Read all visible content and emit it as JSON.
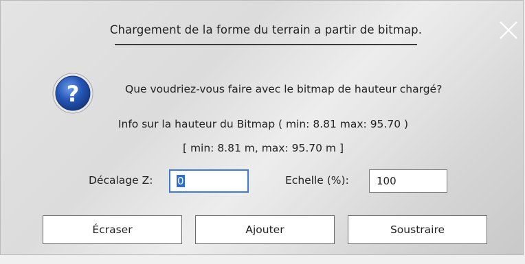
{
  "dialog": {
    "title": "Chargement de la forme du terrain a partir de bitmap.",
    "close_icon": "close-icon",
    "help_icon": "question-mark-icon",
    "question": "Que voudriez-vous faire avec le bitmap de hauteur chargé?",
    "info": "Info sur la hauteur du Bitmap ( min: 8.81 max: 95.70 )",
    "range": "[ min: 8.81 m, max: 95.70 m ]",
    "offset_label": "Décalage Z:",
    "offset_value": "0",
    "scale_label": "Echelle (%):",
    "scale_value": "100",
    "buttons": {
      "overwrite": "Écraser",
      "add": "Ajouter",
      "subtract": "Soustraire"
    },
    "colors": {
      "accent": "#3b7bd4",
      "help_icon": "#1f4fa8"
    }
  }
}
